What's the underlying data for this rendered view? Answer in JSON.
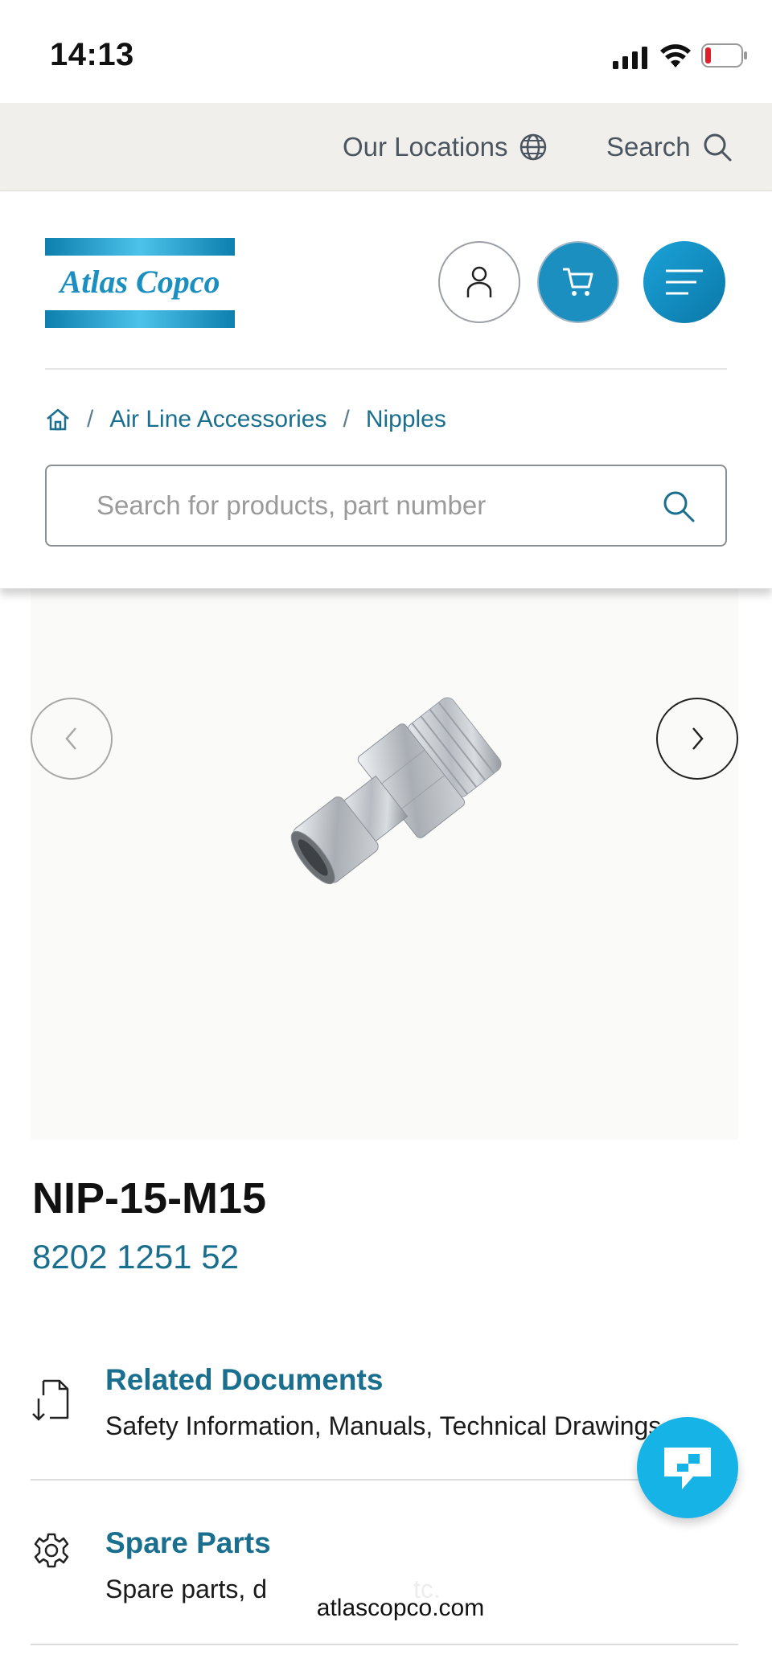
{
  "status_bar": {
    "time": "14:13"
  },
  "utility_bar": {
    "locations_label": "Our Locations",
    "search_label": "Search"
  },
  "header": {
    "logo_text": "Atlas Copco",
    "breadcrumb": [
      "Air Line Accessories",
      "Nipples"
    ],
    "search_placeholder": "Search for products, part number"
  },
  "product": {
    "title": "NIP-15-M15",
    "part_number": "8202 1251 52"
  },
  "sections": [
    {
      "title": "Related Documents",
      "desc": "Safety Information, Manuals, Technical Drawings, etc.",
      "icon": "document-icon"
    },
    {
      "title": "Spare Parts",
      "desc": "Spare parts, d",
      "desc_tail": "tc.",
      "icon": "gear-icon"
    }
  ],
  "browser": {
    "url": "atlascopco.com"
  },
  "colors": {
    "brand": "#1b8fc0",
    "link": "#1a6f8f",
    "chat": "#16b3e6",
    "util_bg": "#f1efeb"
  }
}
